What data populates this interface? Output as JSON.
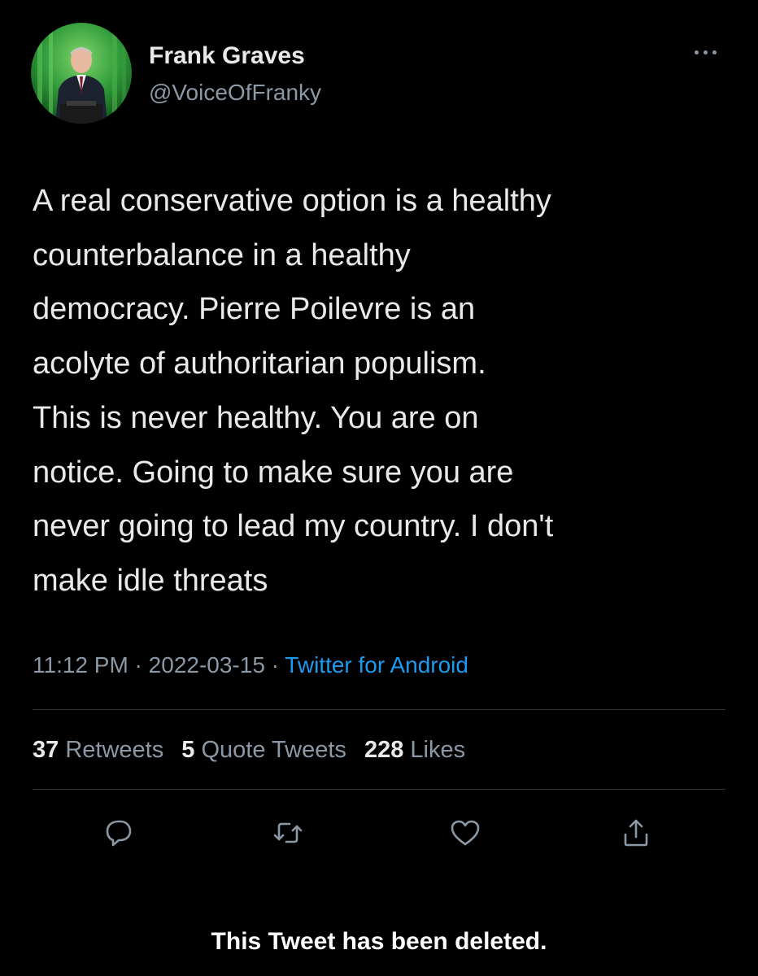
{
  "colors": {
    "background": "#000000",
    "primary_text": "#e7e9ea",
    "secondary_text": "#8b98a5",
    "link": "#1d9bf0",
    "divider": "#2f3336"
  },
  "author": {
    "avatar_icon": "profile-photo-avatar",
    "name": "Frank Graves",
    "handle": "@VoiceOfFranky"
  },
  "more_icon": "more-options-icon",
  "tweet": {
    "lines": [
      "A real conservative option is a healthy",
      "counterbalance in a healthy",
      "democracy.  Pierre Poilevre is an",
      "acolyte of authoritarian populism.",
      "This is never healthy. You are on",
      "notice.  Going to make sure you are",
      "never going to lead my country. I don't",
      "make idle threats"
    ]
  },
  "meta": {
    "time": "11:12 PM",
    "separator": " · ",
    "date": "2022-03-15",
    "source": "Twitter for Android"
  },
  "stats": {
    "retweets": {
      "count": "37",
      "label": "Retweets"
    },
    "quotes": {
      "count": "5",
      "label": "Quote Tweets"
    },
    "likes": {
      "count": "228",
      "label": "Likes"
    }
  },
  "actions": [
    {
      "icon": "reply-icon"
    },
    {
      "icon": "retweet-icon"
    },
    {
      "icon": "like-heart-icon"
    },
    {
      "icon": "share-icon"
    }
  ],
  "notice": "This Tweet has been deleted."
}
